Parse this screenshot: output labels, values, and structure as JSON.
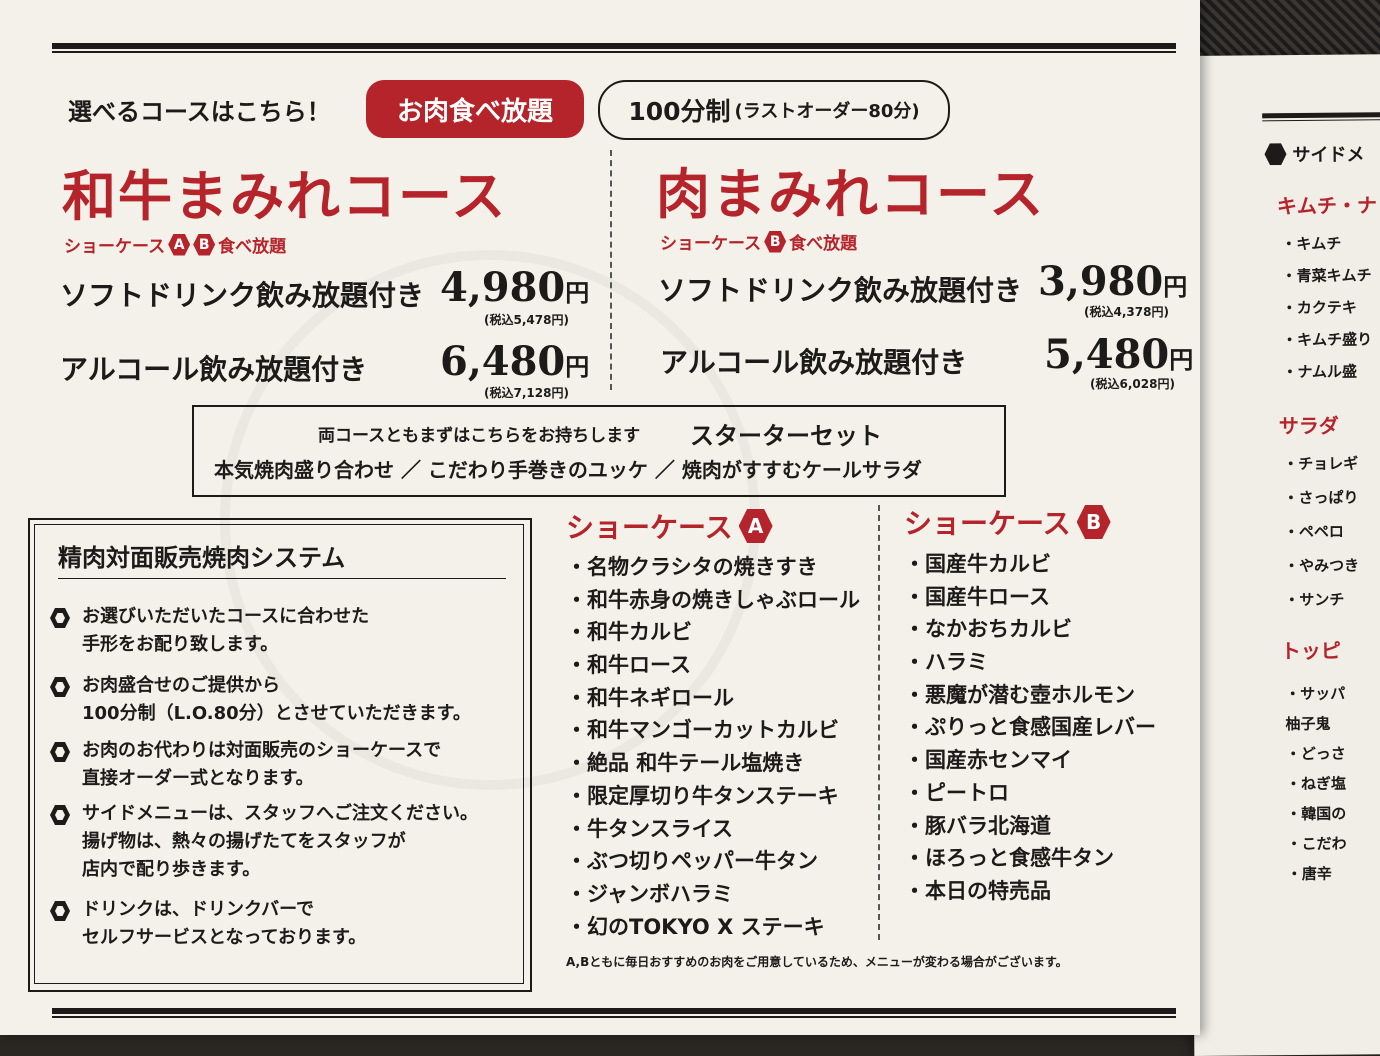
{
  "header": {
    "lead": "選べるコースはこちら！",
    "tag_red": "お肉食べ放題",
    "duration_main": "100分制",
    "duration_sub": "(ラストオーダー80分)"
  },
  "courses": [
    {
      "title": "和牛まみれコース",
      "showcase_prefix": "ショーケース",
      "showcase_badges": [
        "A",
        "B"
      ],
      "showcase_suffix": "食べ放題",
      "rows": [
        {
          "label": "ソフトドリンク飲み放題付き",
          "price": "4,980",
          "yen": "円",
          "tax": "(税込5,478円)"
        },
        {
          "label": "アルコール飲み放題付き",
          "price": "6,480",
          "yen": "円",
          "tax": "(税込7,128円)"
        }
      ]
    },
    {
      "title": "肉まみれコース",
      "showcase_prefix": "ショーケース",
      "showcase_badges": [
        "B"
      ],
      "showcase_suffix": "食べ放題",
      "rows": [
        {
          "label": "ソフトドリンク飲み放題付き",
          "price": "3,980",
          "yen": "円",
          "tax": "(税込4,378円)"
        },
        {
          "label": "アルコール飲み放題付き",
          "price": "5,480",
          "yen": "円",
          "tax": "(税込6,028円)"
        }
      ]
    }
  ],
  "starter": {
    "line1": "両コースともまずはこちらをお持ちします",
    "title": "スターターセット",
    "line2": "本気焼肉盛り合わせ ／ こだわり手巻きのユッケ ／ 焼肉がすすむケールサラダ"
  },
  "system": {
    "title": "精肉対面販売焼肉システム",
    "items": [
      "お選びいただいたコースに合わせた\n手形をお配り致します。",
      "お肉盛合せのご提供から\n100分制（L.O.80分）とさせていただきます。",
      "お肉のお代わりは対面販売のショーケースで\n直接オーダー式となります。",
      "サイドメニューは、スタッフへご注文ください。\n揚げ物は、熱々の揚げたてをスタッフが\n店内で配り歩きます。",
      "ドリンクは、ドリンクバーで\nセルフサービスとなっております。"
    ]
  },
  "showcase_a": {
    "title": "ショーケース",
    "badge": "A",
    "items": [
      "・名物クラシタの焼きすき",
      "・和牛赤身の焼きしゃぶロール",
      "・和牛カルビ",
      "・和牛ロース",
      "・和牛ネギロール",
      "・和牛マンゴーカットカルビ",
      "・絶品 和牛テール塩焼き",
      "・限定厚切り牛タンステーキ",
      "・牛タンスライス",
      "・ぶつ切りペッパー牛タン",
      "・ジャンボハラミ",
      "・幻のTOKYO X ステーキ"
    ]
  },
  "showcase_b": {
    "title": "ショーケース",
    "badge": "B",
    "items": [
      "・国産牛カルビ",
      "・国産牛ロース",
      "・なかおちカルビ",
      "・ハラミ",
      "・悪魔が潜む壺ホルモン",
      "・ぷりっと食感国産レバー",
      "・国産赤センマイ",
      "・ピートロ",
      "・豚バラ北海道",
      "・ほろっと食感牛タン",
      "・本日の特売品"
    ]
  },
  "note": "A,Bともに毎日おすすめのお肉をご用意しているため、メニューが変わる場合がございます。",
  "side_page": {
    "heading": "サイドメ",
    "sections": [
      {
        "title": "キムチ・ナ",
        "items": [
          "・キムチ",
          "・青菜キムチ",
          "・カクテキ",
          "・キムチ盛り",
          "・ナムル盛"
        ]
      },
      {
        "title": "サラダ",
        "items": [
          "・チョレギ",
          "・さっぱり",
          "・ペペロ",
          "・やみつき",
          "・サンチ"
        ]
      },
      {
        "title": "トッピ",
        "items": [
          "・サッパ",
          "柚子鬼",
          "・どっさ",
          "・ねぎ塩",
          "・韓国の",
          "・こだわ",
          "・唐辛"
        ]
      }
    ]
  },
  "colors": {
    "accent_red": "#b5242a",
    "paper": "#f4f1ea",
    "ink": "#1d1b19"
  }
}
